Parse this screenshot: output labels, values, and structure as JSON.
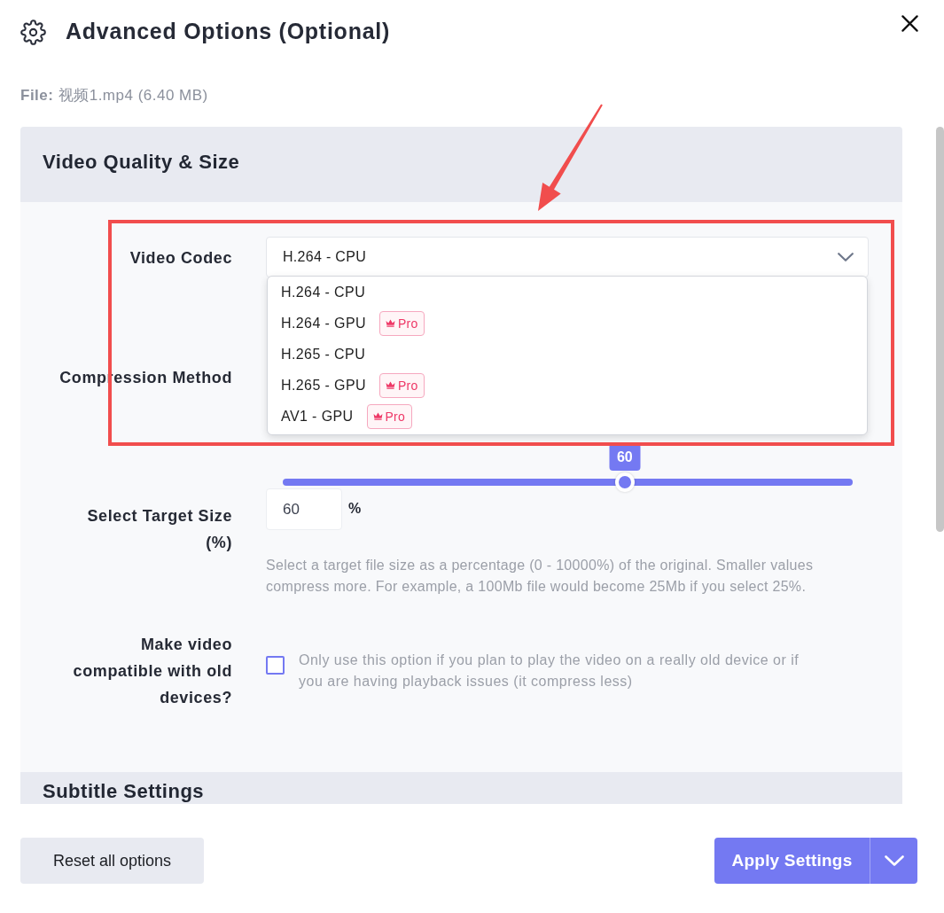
{
  "dialog": {
    "title": "Advanced Options (Optional)"
  },
  "file_info": "**File:** 视频1.mp4 (6.40 MB)",
  "sections": [
    {
      "title": "Video Quality & Size",
      "fields": [
        {
          "kind": "select",
          "label": "Video Codec",
          "value": "H.264 - CPU",
          "expanded": true,
          "options": [
            {
              "label": "H.264 - CPU"
            },
            {
              "label": "H.264 - GPU",
              "badge": "Pro"
            },
            {
              "label": "H.265 - CPU"
            },
            {
              "label": "H.265 - GPU",
              "badge": "Pro"
            },
            {
              "label": "AV1 - GPU",
              "badge": "Pro"
            }
          ]
        },
        {
          "kind": "select",
          "label": "Compression Method"
        },
        {
          "kind": "slider",
          "level": 0.6,
          "value_label": "60"
        },
        {
          "kind": "number",
          "label": "Select Target Size (%)",
          "value": "60",
          "unit": "%",
          "hint": "Select a target file size as a percentage (0 - 10000%) of the original. Smaller values compress more. For example, a 100Mb file would become 25Mb if you select 25%."
        },
        {
          "kind": "checkbox",
          "label": "Make video compatible with old devices?",
          "checked": false,
          "hint": "Only use this option if you plan to play the video on a really old device or if you are having playback issues (it compress less)"
        }
      ]
    },
    {
      "title": "Subtitle Settings"
    }
  ],
  "footer": {
    "buttons": [
      {
        "kind": "secondary",
        "label": "Reset all options"
      },
      {
        "kind": "split",
        "label": "Apply Settings"
      }
    ]
  },
  "annotations": {
    "highlight_frame": true,
    "pointer_arrow": true
  }
}
